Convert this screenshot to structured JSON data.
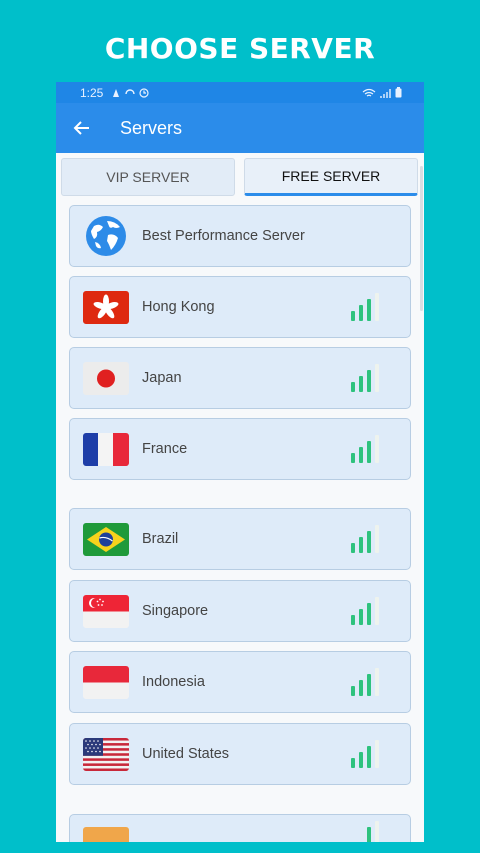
{
  "headline": "CHOOSE SERVER",
  "status": {
    "time": "1:25"
  },
  "appbar": {
    "title": "Servers"
  },
  "tabs": [
    {
      "label": "VIP SERVER",
      "active": false
    },
    {
      "label": "FREE SERVER",
      "active": true
    }
  ],
  "servers": [
    {
      "name": "Best Performance Server",
      "icon": "globe-icon",
      "signal": null
    },
    {
      "name": "Hong Kong",
      "icon": "hong-kong-flag-icon",
      "signal": 3
    },
    {
      "name": "Japan",
      "icon": "japan-flag-icon",
      "signal": 3
    },
    {
      "name": "France",
      "icon": "france-flag-icon",
      "signal": 3
    },
    {
      "name": "Brazil",
      "icon": "brazil-flag-icon",
      "signal": 3
    },
    {
      "name": "Singapore",
      "icon": "singapore-flag-icon",
      "signal": 3
    },
    {
      "name": "Indonesia",
      "icon": "indonesia-flag-icon",
      "signal": 3
    },
    {
      "name": "United States",
      "icon": "usa-flag-icon",
      "signal": 3
    }
  ],
  "colors": {
    "background": "#00bfca",
    "appbar": "#2b8cea",
    "card": "#deebf9",
    "signal": "#2ec27e"
  }
}
